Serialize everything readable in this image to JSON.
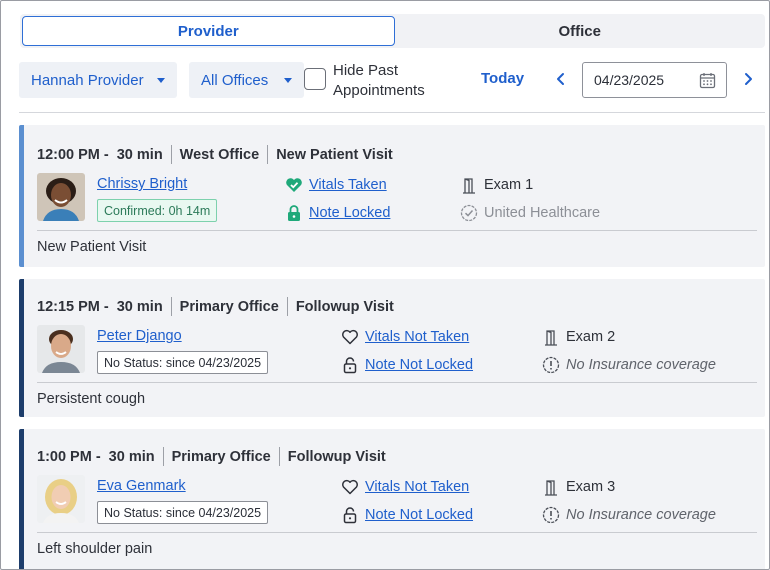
{
  "tabs": [
    {
      "label": "Provider",
      "active": true
    },
    {
      "label": "Office",
      "active": false
    }
  ],
  "filters": {
    "provider": "Hannah Provider",
    "office": "All Offices",
    "hide_past_label": "Hide Past Appointments",
    "hide_past_checked": false,
    "today_label": "Today",
    "date_value": "04/23/2025"
  },
  "colors": {
    "accent": "#1f5fcc",
    "card_bg": "#f2f3f6",
    "first_card_bar": "#5b8fd0",
    "card_bar": "#1d3d6b",
    "vitals_taken": "#1fa97a"
  },
  "appointments": [
    {
      "time": "12:00 PM -",
      "duration": "30 min",
      "office": "West Office",
      "visit_type": "New Patient Visit",
      "patient": "Chrissy Bright",
      "status": "Confirmed: 0h 14m",
      "vitals": "Vitals Taken",
      "vitals_icon": "heart-check-icon",
      "note": "Note Locked",
      "note_icon": "lock-closed-icon",
      "room": "Exam 1",
      "insurance": "United Healthcare",
      "insurance_icon": "check-circle-icon",
      "reason": "New Patient Visit"
    },
    {
      "time": "12:15 PM -",
      "duration": "30 min",
      "office": "Primary Office",
      "visit_type": "Followup Visit",
      "patient": "Peter Django",
      "status": "No Status: since 04/23/2025",
      "vitals": "Vitals Not Taken",
      "vitals_icon": "heart-outline-icon",
      "note": "Note Not Locked",
      "note_icon": "lock-open-icon",
      "room": "Exam 2",
      "insurance": "No Insurance coverage",
      "insurance_icon": "alert-circle-icon",
      "reason": "Persistent cough"
    },
    {
      "time": "1:00 PM -",
      "duration": "30 min",
      "office": "Primary Office",
      "visit_type": "Followup Visit",
      "patient": "Eva Genmark",
      "status": "No Status: since 04/23/2025",
      "vitals": "Vitals Not Taken",
      "vitals_icon": "heart-outline-icon",
      "note": "Note Not Locked",
      "note_icon": "lock-open-icon",
      "room": "Exam 3",
      "insurance": "No Insurance coverage",
      "insurance_icon": "alert-circle-icon",
      "reason": "Left shoulder pain"
    }
  ]
}
